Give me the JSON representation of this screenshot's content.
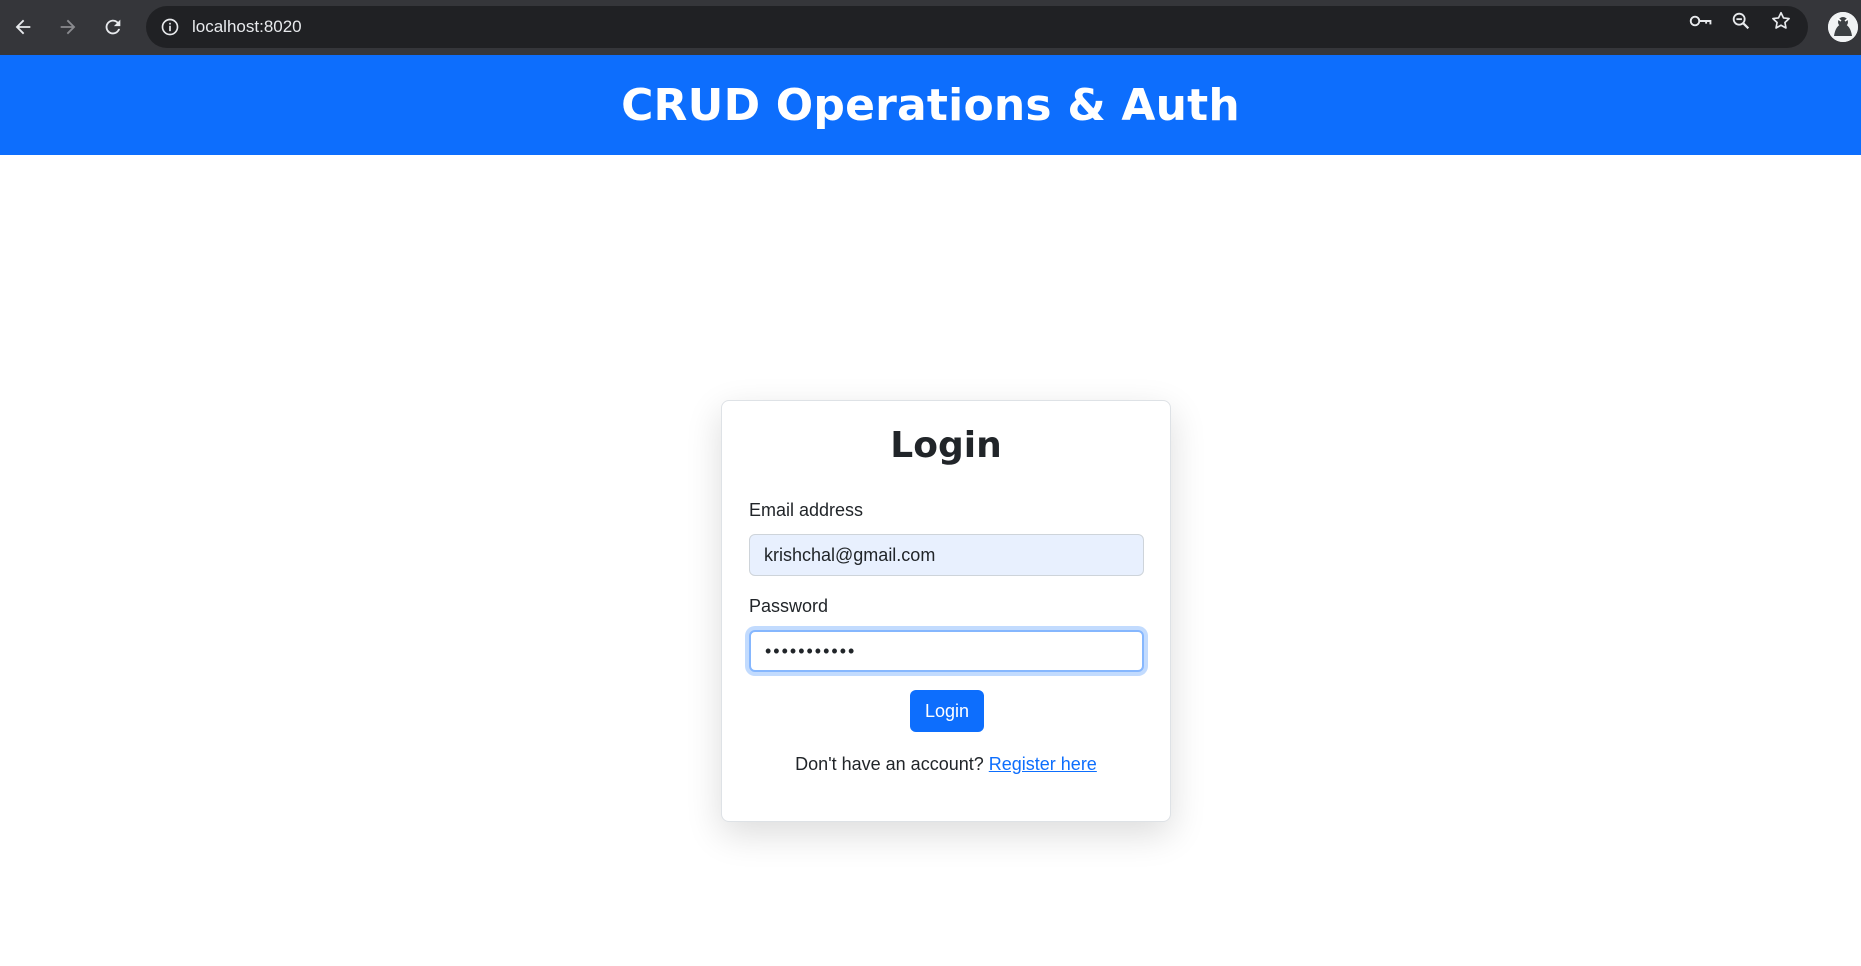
{
  "browser": {
    "url": "localhost:8020",
    "icons": [
      "back-arrow-icon",
      "forward-arrow-icon",
      "reload-icon",
      "site-info-icon",
      "password-key-icon",
      "zoom-icon",
      "bookmark-star-icon",
      "profile-avatar-icon"
    ]
  },
  "header": {
    "title": "CRUD Operations & Auth",
    "background": "#0d6efd"
  },
  "login": {
    "title": "Login",
    "email_label": "Email address",
    "email_value": "krishchal@gmail.com",
    "password_label": "Password",
    "password_value": "•••••••••••",
    "submit_label": "Login",
    "footer_text": "Don't have an account?",
    "register_link": "Register here"
  },
  "colors": {
    "primary": "#0d6efd",
    "autofill": "#e8f0fe",
    "text": "#212529"
  }
}
